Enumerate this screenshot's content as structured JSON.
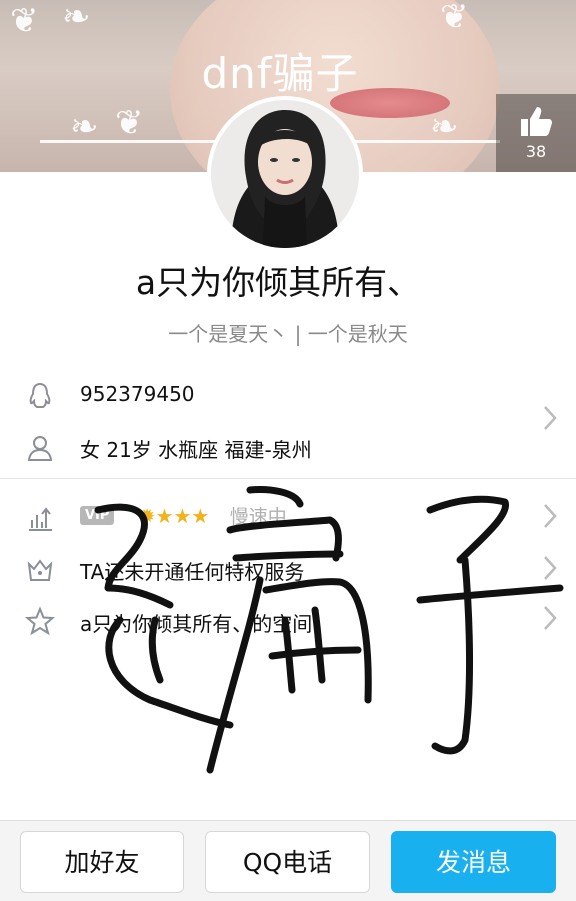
{
  "header": {
    "nickname": "dnf骗子",
    "like_count": "38"
  },
  "profile": {
    "display_name": "a只为你倾其所有、",
    "signature": "一个是夏天丶 | 一个是秋天"
  },
  "info": {
    "qq_number": "952379450",
    "details": "女  21岁  水瓶座  福建-泉州"
  },
  "status": {
    "vip_badge": "VIP",
    "level_icons": "✹★★★",
    "speed_text": "慢速中",
    "privilege_text": "TA还未开通任何特权服务",
    "space_text": "a只为你倾其所有、的空间"
  },
  "overlay": {
    "scribble_text": "骗子"
  },
  "actions": {
    "add_friend": "加好友",
    "qq_call": "QQ电话",
    "send_message": "发消息"
  },
  "colors": {
    "accent": "#19b0f0",
    "icon_gray": "#8a8f98",
    "star": "#f4b21a"
  },
  "icons": {
    "qq": "qq-penguin-icon",
    "person": "person-icon",
    "level": "level-up-icon",
    "crown": "crown-icon",
    "star": "star-icon",
    "like": "thumb-up-icon",
    "chevron": "chevron-right-icon"
  }
}
